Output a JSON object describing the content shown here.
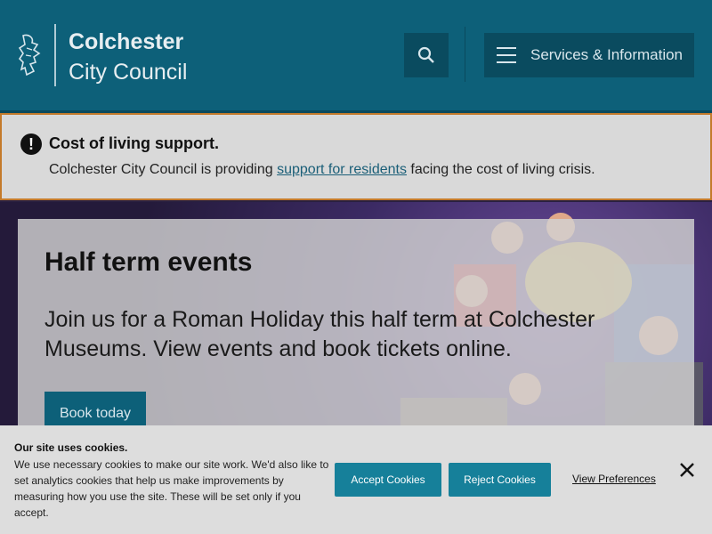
{
  "header": {
    "org_line1": "Colchester",
    "org_line2": "City Council",
    "menu_label": "Services & Information",
    "logo_icon": "council-crest-icon",
    "search_icon": "search-icon",
    "menu_icon": "hamburger-menu-icon",
    "bg_color": "#0d6079"
  },
  "alert": {
    "title": "Cost of living support.",
    "text_before": "Colchester City Council is providing ",
    "link_text": "support for residents",
    "text_after": " facing the cost of living crisis.",
    "icon": "exclamation-icon",
    "border_color": "#c47a2a"
  },
  "hero": {
    "title": "Half term events",
    "text": "Join us for a Roman Holiday this half term at Colchester Museums. View events and book tickets online.",
    "button_label": "Book today"
  },
  "cookie": {
    "title": "Our site uses cookies.",
    "text": "We use necessary cookies to make our site work. We'd also like to set analytics cookies that help us make improvements by measuring how you use the site. These will be set only if you accept.",
    "accept_label": "Accept Cookies",
    "reject_label": "Reject Cookies",
    "prefs_label": "View Preferences",
    "close_icon": "close-icon",
    "button_color": "#16809a"
  }
}
